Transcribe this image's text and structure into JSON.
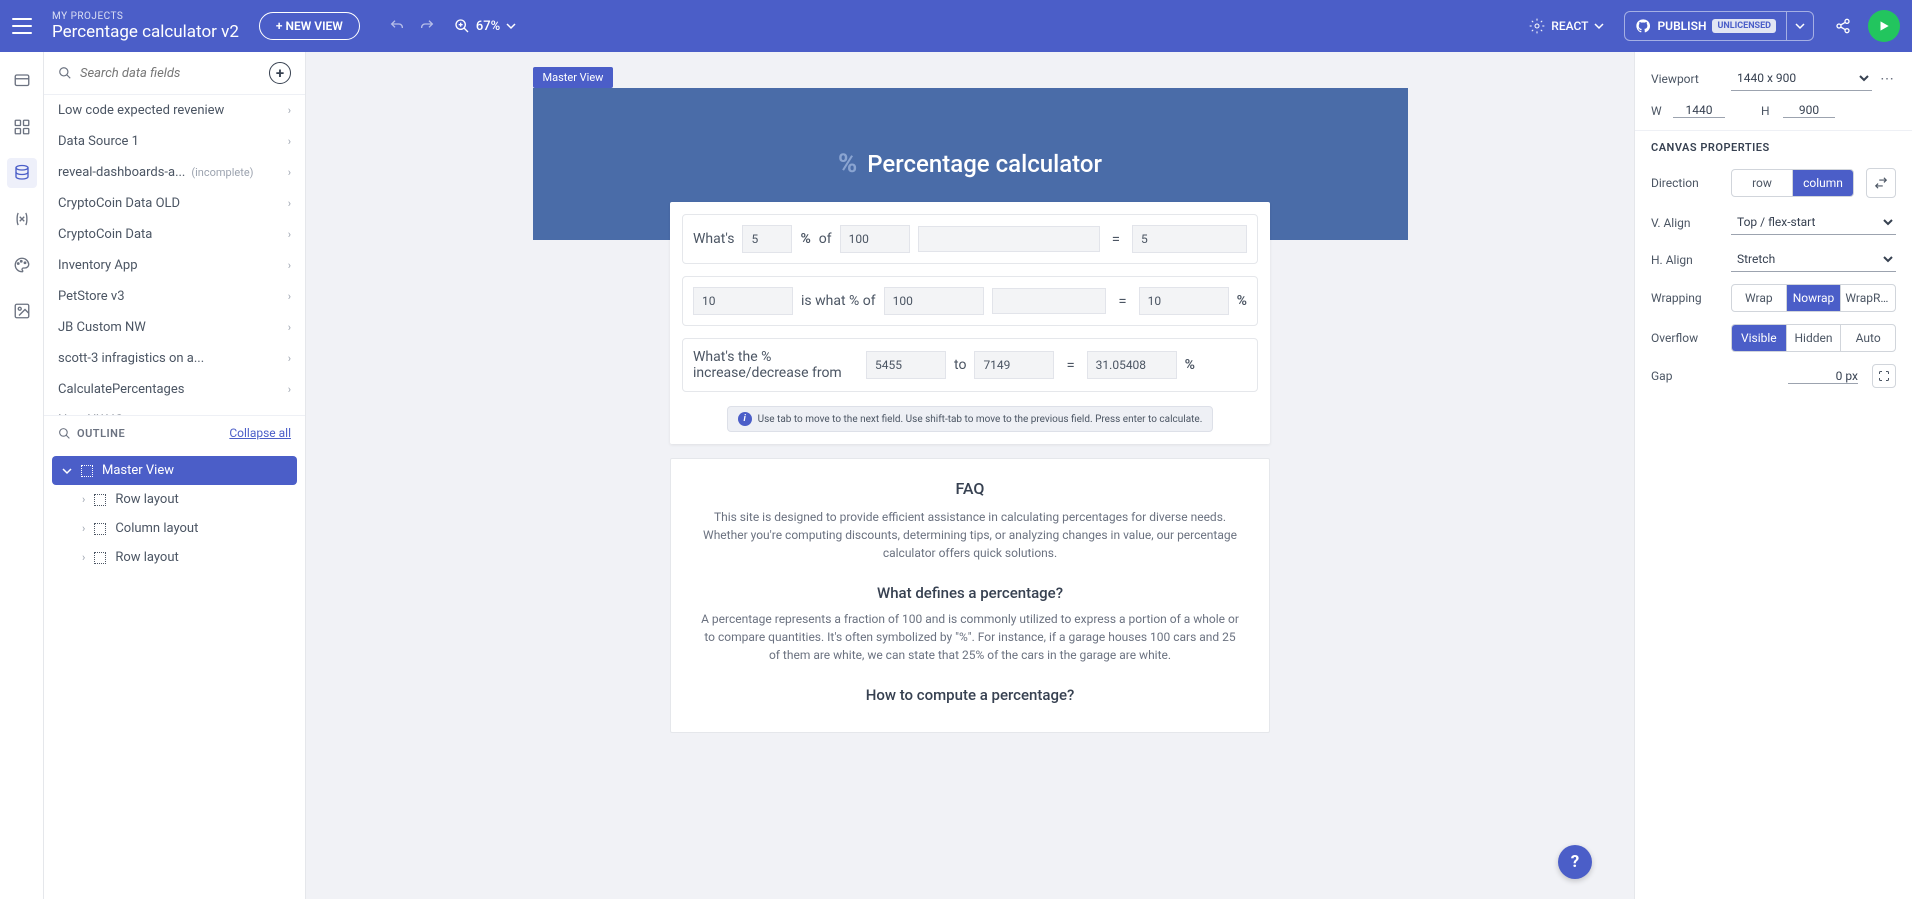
{
  "header": {
    "breadcrumb_label": "MY PROJECTS",
    "project_title": "Percentage calculator v2",
    "new_view": "+ NEW VIEW",
    "zoom": "67%",
    "framework": "REACT",
    "publish": "PUBLISH",
    "license_badge": "UNLICENSED"
  },
  "left_panel": {
    "search_placeholder": "Search data fields",
    "data_sources": [
      {
        "name": "Low code expected reveniew",
        "meta": ""
      },
      {
        "name": "Data Source 1",
        "meta": ""
      },
      {
        "name": "reveal-dashboards-a...",
        "meta": "(incomplete)"
      },
      {
        "name": "CryptoCoin Data OLD",
        "meta": ""
      },
      {
        "name": "CryptoCoin Data",
        "meta": ""
      },
      {
        "name": "Inventory App",
        "meta": ""
      },
      {
        "name": "PetStore v3",
        "meta": ""
      },
      {
        "name": "JB Custom NW",
        "meta": ""
      },
      {
        "name": "scott-3 infragistics on a...",
        "meta": ""
      },
      {
        "name": "CalculatePercentages",
        "meta": ""
      },
      {
        "name": "New NW IG",
        "meta": ""
      }
    ],
    "outline_label": "OUTLINE",
    "collapse_all": "Collapse all",
    "tree": {
      "root": "Master View",
      "children": [
        "Row layout",
        "Column layout",
        "Row layout"
      ]
    }
  },
  "canvas": {
    "view_tag": "Master View",
    "hero_title": "Percentage calculator",
    "row1": {
      "label_whats": "What's",
      "val_a": "5",
      "label_of": "of",
      "val_b": "100",
      "result": "5"
    },
    "row2": {
      "val_a": "10",
      "label_iswhat": "is what % of",
      "val_b": "100",
      "result": "10"
    },
    "row3": {
      "label": "What's the % increase/decrease from",
      "val_a": "5455",
      "label_to": "to",
      "val_b": "7149",
      "result": "31.05408"
    },
    "tip": "Use tab to move to the next field. Use shift-tab to move to the previous field. Press enter to calculate.",
    "faq": {
      "title": "FAQ",
      "intro": "This site is designed to provide efficient assistance in calculating percentages for diverse needs. Whether you're computing discounts, determining tips, or analyzing changes in value, our percentage calculator offers quick solutions.",
      "q1_title": "What defines a percentage?",
      "q1_body": "A percentage represents a fraction of 100 and is commonly utilized to express a portion of a whole or to compare quantities. It's often symbolized by \"%\". For instance, if a garage houses 100 cars and 25 of them are white, we can state that 25% of the cars in the garage are white.",
      "q2_title": "How to compute a percentage?"
    }
  },
  "right_panel": {
    "viewport_label": "Viewport",
    "viewport_value": "1440 x 900",
    "w_label": "W",
    "w_value": "1440",
    "h_label": "H",
    "h_value": "900",
    "section": "CANVAS PROPERTIES",
    "direction_label": "Direction",
    "direction_opts": [
      "row",
      "column"
    ],
    "direction_active": "column",
    "valign_label": "V. Align",
    "valign_value": "Top / flex-start",
    "halign_label": "H. Align",
    "halign_value": "Stretch",
    "wrapping_label": "Wrapping",
    "wrapping_opts": [
      "Wrap",
      "Nowrap",
      "WrapRe..."
    ],
    "wrapping_active": "Nowrap",
    "overflow_label": "Overflow",
    "overflow_opts": [
      "Visible",
      "Hidden",
      "Auto"
    ],
    "overflow_active": "Visible",
    "gap_label": "Gap",
    "gap_value": "0 px"
  },
  "help": "?"
}
